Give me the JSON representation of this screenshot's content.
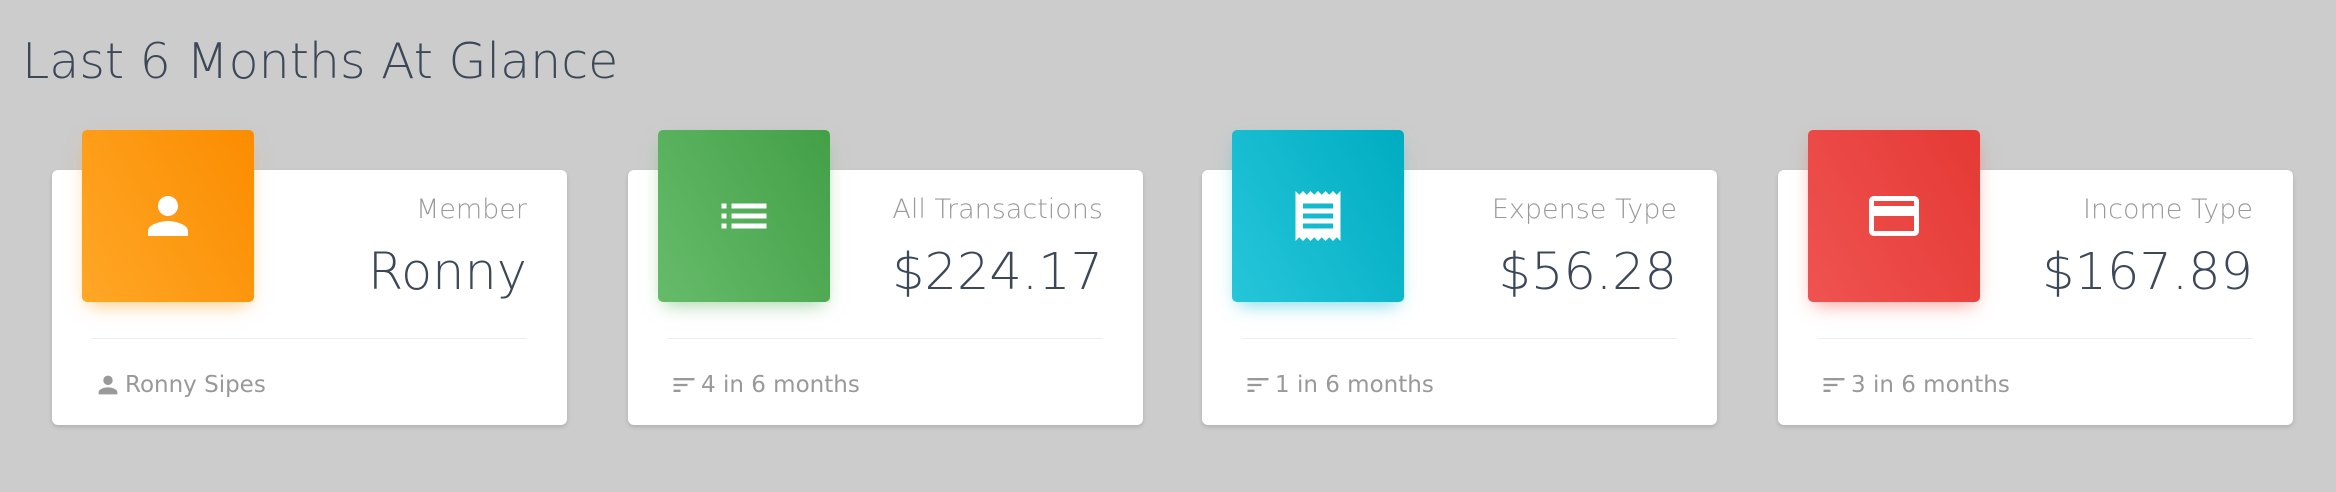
{
  "page": {
    "title": "Last 6 Months At Glance"
  },
  "cards": [
    {
      "category": "Member",
      "value": "Ronny",
      "footer": "Ronny Sipes",
      "icon": "person-icon",
      "footer_icon": "person-small-icon",
      "color": "#fb8c00"
    },
    {
      "category": "All Transactions",
      "value": "$224.17",
      "footer": "4 in 6 months",
      "icon": "list-icon",
      "footer_icon": "sort-icon",
      "color": "#43a047"
    },
    {
      "category": "Expense Type",
      "value": "$56.28",
      "footer": "1 in 6 months",
      "icon": "receipt-icon",
      "footer_icon": "sort-icon",
      "color": "#00acc1"
    },
    {
      "category": "Income Type",
      "value": "$167.89",
      "footer": "3 in 6 months",
      "icon": "credit-card-icon",
      "footer_icon": "sort-icon",
      "color": "#e53935"
    }
  ]
}
